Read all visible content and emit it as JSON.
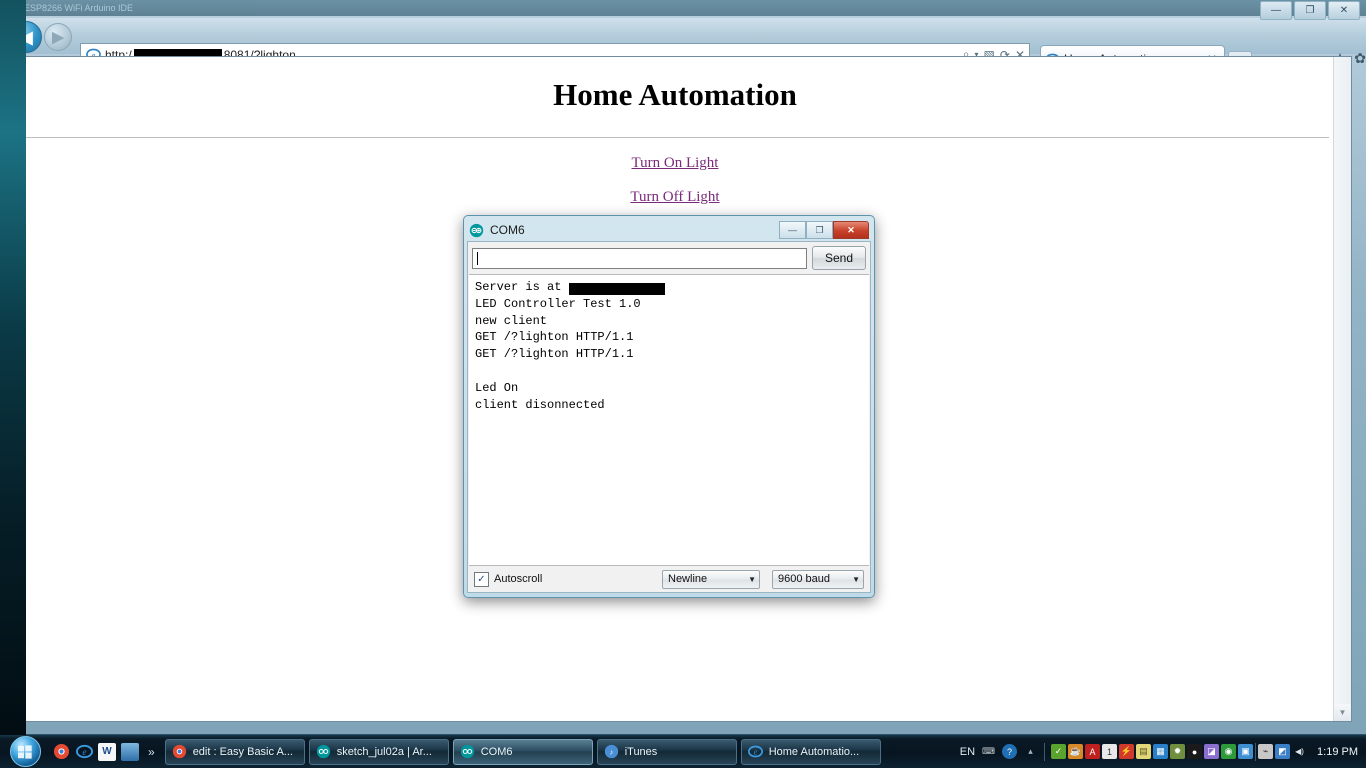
{
  "desktop": {
    "background_window_title": "ESP8266 WiFi Arduino IDE"
  },
  "browser": {
    "window_controls": {
      "minimize": "—",
      "maximize": "❐",
      "close": "✕"
    },
    "back_label": "◀",
    "forward_label": "▶",
    "address": {
      "scheme_text": "http:/",
      "redacted": true,
      "port_path": "8081/?lighton",
      "favicon": "ie-icon"
    },
    "address_icons": [
      {
        "name": "search-icon",
        "glyph": "⌕"
      },
      {
        "name": "search-dropdown-icon",
        "glyph": "▾"
      },
      {
        "name": "compatibility-view-icon",
        "glyph": "▧"
      },
      {
        "name": "refresh-icon",
        "glyph": "⟳"
      },
      {
        "name": "stop-icon",
        "glyph": "✕"
      }
    ],
    "tabs": [
      {
        "label": "Home Automation",
        "favicon": "ie-icon",
        "close": "✕",
        "active": true
      }
    ],
    "tool_icons": [
      {
        "name": "home-icon",
        "glyph": "⌂"
      },
      {
        "name": "favorites-star-icon",
        "glyph": "★"
      },
      {
        "name": "settings-gear-icon",
        "glyph": "✿"
      }
    ]
  },
  "page": {
    "title": "Home Automation",
    "links": [
      {
        "label": "Turn On Light"
      },
      {
        "label": "Turn Off Light"
      }
    ],
    "scrollbar_down_glyph": "▼"
  },
  "serial_monitor": {
    "title": "COM6",
    "logo": "arduino-infinity-logo",
    "window_controls": {
      "minimize": "—",
      "maximize": "❐",
      "close": "✕"
    },
    "input_value": "",
    "send_label": "Send",
    "output_lines": [
      {
        "text": "Server is at ",
        "redacted_after": true
      },
      {
        "text": "LED Controller Test 1.0"
      },
      {
        "text": "new client"
      },
      {
        "text": "GET /?lighton HTTP/1.1"
      },
      {
        "text": "GET /?lighton HTTP/1.1"
      },
      {
        "text": ""
      },
      {
        "text": "Led On"
      },
      {
        "text": "client disonnected"
      }
    ],
    "autoscroll": {
      "label": "Autoscroll",
      "checked": true,
      "check_glyph": "✓"
    },
    "line_ending": {
      "value": "Newline",
      "arrow": "▼"
    },
    "baud_rate": {
      "value": "9600 baud",
      "arrow": "▼"
    }
  },
  "taskbar": {
    "start_label": "",
    "quick_launch": [
      {
        "name": "chrome-icon",
        "glyph": "◍",
        "color": "#d9472b"
      },
      {
        "name": "internet-explorer-icon",
        "glyph": "e",
        "color": "#2b7fc4"
      },
      {
        "name": "word-icon",
        "glyph": "W",
        "color": "#ffffff"
      },
      {
        "name": "show-desktop-icon",
        "glyph": "▭",
        "color": "#8fb6d6"
      }
    ],
    "overflow_glyph": "»",
    "buttons": [
      {
        "label": "edit : Easy Basic A...",
        "icon": "chrome-icon",
        "active": false
      },
      {
        "label": "sketch_jul02a | Ar...",
        "icon": "arduino-icon",
        "active": false
      },
      {
        "label": "COM6",
        "icon": "arduino-icon",
        "active": true
      },
      {
        "label": "iTunes",
        "icon": "itunes-icon",
        "active": false
      },
      {
        "label": "Home Automatio...",
        "icon": "internet-explorer-icon",
        "active": false
      }
    ],
    "language": "EN",
    "tray_icons": [
      {
        "name": "keyboard-icon",
        "glyph": "⌨",
        "color": "#c9cfd4"
      },
      {
        "name": "help-icon",
        "glyph": "?",
        "color": "#1f6fb5"
      },
      {
        "name": "show-hidden-icons-icon",
        "glyph": "▴",
        "color": "#9fb4c2"
      },
      {
        "name": "antivirus-icon",
        "glyph": "✓",
        "color": "#5aa32e"
      },
      {
        "name": "java-icon",
        "glyph": "☕",
        "color": "#d98826"
      },
      {
        "name": "ati-catalyst-icon",
        "glyph": "A",
        "color": "#c02020"
      },
      {
        "name": "onedrive-icon",
        "glyph": "1",
        "color": "#e8e8e8"
      },
      {
        "name": "flash-icon",
        "glyph": "⚡",
        "color": "#cf3a2a"
      },
      {
        "name": "note-icon",
        "glyph": "▤",
        "color": "#e3d77a"
      },
      {
        "name": "excel-icon",
        "glyph": "▦",
        "color": "#2a7fc9"
      },
      {
        "name": "install-icon",
        "glyph": "✹",
        "color": "#6f8f3f"
      },
      {
        "name": "dark-icon",
        "glyph": "●",
        "color": "#1a1a1a"
      },
      {
        "name": "media-icon",
        "glyph": "◪",
        "color": "#8b6fd0"
      },
      {
        "name": "paint-icon",
        "glyph": "◉",
        "color": "#2f9a3a"
      },
      {
        "name": "update-icon",
        "glyph": "▣",
        "color": "#3d8fd1"
      },
      {
        "name": "power-icon",
        "glyph": "⌁",
        "color": "#c8c8c8"
      },
      {
        "name": "network-icon",
        "glyph": "◩",
        "color": "#3b7fc6"
      },
      {
        "name": "volume-icon",
        "glyph": "◀)",
        "color": "#dfe7ec"
      }
    ],
    "clock": "1:19 PM"
  }
}
